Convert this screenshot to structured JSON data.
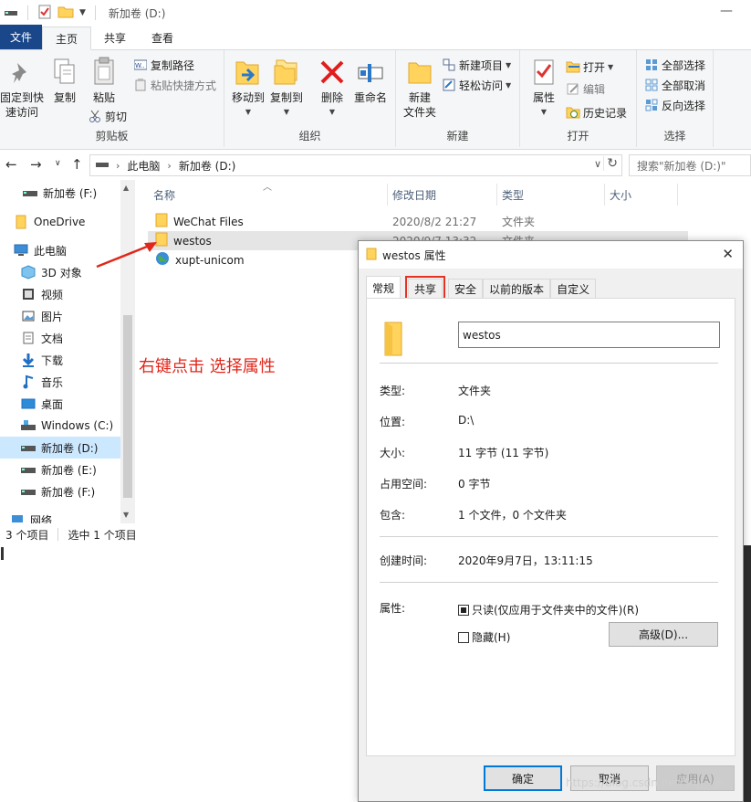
{
  "titlebar": {
    "title": "新加卷 (D:)",
    "minimize": "—"
  },
  "ribbon_tabs": [
    "文件",
    "主页",
    "共享",
    "查看"
  ],
  "ribbon": {
    "clipboard": {
      "pin": "固定到快\n速访问",
      "copy": "复制",
      "paste": "粘贴",
      "copy_path": "复制路径",
      "paste_shortcut": "粘贴快捷方式",
      "cut": "剪切",
      "label": "剪贴板"
    },
    "organize": {
      "move_to": "移动到",
      "copy_to": "复制到",
      "delete": "删除",
      "rename": "重命名",
      "label": "组织"
    },
    "new": {
      "new_folder": "新建\n文件夹",
      "new_item": "新建项目",
      "easy_access": "轻松访问",
      "label": "新建"
    },
    "open": {
      "properties": "属性",
      "open": "打开",
      "edit": "编辑",
      "history": "历史记录",
      "label": "打开"
    },
    "select": {
      "select_all": "全部选择",
      "select_none": "全部取消",
      "invert": "反向选择",
      "label": "选择"
    }
  },
  "address": {
    "breadcrumb": [
      "此电脑",
      "新加卷 (D:)"
    ],
    "search_placeholder": "搜索\"新加卷 (D:)\""
  },
  "sidebar": [
    {
      "label": "新加卷 (F:)",
      "icon": "drive-icon"
    },
    {
      "label": "OneDrive",
      "icon": "folder-icon"
    },
    {
      "label": "此电脑",
      "icon": "pc-icon"
    },
    {
      "label": "3D 对象",
      "icon": "cube-icon"
    },
    {
      "label": "视频",
      "icon": "video-icon"
    },
    {
      "label": "图片",
      "icon": "picture-icon"
    },
    {
      "label": "文档",
      "icon": "document-icon"
    },
    {
      "label": "下载",
      "icon": "download-icon"
    },
    {
      "label": "音乐",
      "icon": "music-icon"
    },
    {
      "label": "桌面",
      "icon": "desktop-icon"
    },
    {
      "label": "Windows (C:)",
      "icon": "drive-icon"
    },
    {
      "label": "新加卷 (D:)",
      "icon": "drive-icon"
    },
    {
      "label": "新加卷 (E:)",
      "icon": "drive-icon"
    },
    {
      "label": "新加卷 (F:)",
      "icon": "drive-icon"
    },
    {
      "label": "网络",
      "icon": "network-icon"
    }
  ],
  "columns": [
    "名称",
    "修改日期",
    "类型",
    "大小"
  ],
  "files": [
    {
      "name": "WeChat Files",
      "date": "2020/8/2 21:27",
      "type": "文件夹"
    },
    {
      "name": "westos",
      "date": "2020/9/7 13:32",
      "type": "文件夹"
    },
    {
      "name": "xupt-unicom",
      "date": "",
      "type": ""
    }
  ],
  "annotation": "右键点击 选择属性",
  "status": {
    "count": "3 个项目",
    "selected": "选中 1 个项目"
  },
  "dialog": {
    "title": "westos 属性",
    "close": "✕",
    "tabs": [
      "常规",
      "共享",
      "安全",
      "以前的版本",
      "自定义"
    ],
    "name": "westos",
    "props": [
      {
        "label": "类型:",
        "value": "文件夹"
      },
      {
        "label": "位置:",
        "value": "D:\\"
      },
      {
        "label": "大小:",
        "value": "11 字节 (11 字节)"
      },
      {
        "label": "占用空间:",
        "value": "0 字节"
      },
      {
        "label": "包含:",
        "value": "1 个文件，0 个文件夹"
      },
      {
        "label": "创建时间:",
        "value": "2020年9月7日，13:11:15"
      }
    ],
    "attributes_label": "属性:",
    "readonly": "只读(仅应用于文件夹中的文件)(R)",
    "hidden": "隐藏(H)",
    "advanced": "高级(D)...",
    "ok": "确定",
    "cancel": "取消",
    "apply": "应用(A)"
  },
  "watermark": "https://blog.csdn.net/Snjj_ @"
}
